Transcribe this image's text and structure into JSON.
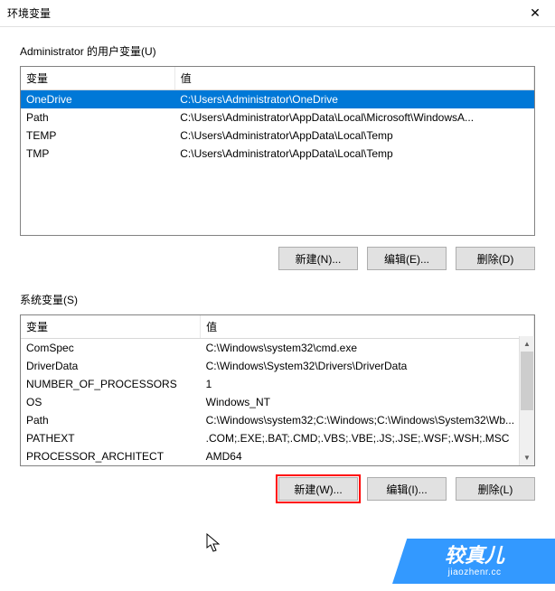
{
  "window": {
    "title": "环境变量"
  },
  "user_section": {
    "label": "Administrator 的用户变量(U)",
    "headers": {
      "variable": "变量",
      "value": "值"
    },
    "rows": [
      {
        "variable": "OneDrive",
        "value": "C:\\Users\\Administrator\\OneDrive",
        "selected": true
      },
      {
        "variable": "Path",
        "value": "C:\\Users\\Administrator\\AppData\\Local\\Microsoft\\WindowsA...",
        "selected": false
      },
      {
        "variable": "TEMP",
        "value": "C:\\Users\\Administrator\\AppData\\Local\\Temp",
        "selected": false
      },
      {
        "variable": "TMP",
        "value": "C:\\Users\\Administrator\\AppData\\Local\\Temp",
        "selected": false
      }
    ],
    "buttons": {
      "new": "新建(N)...",
      "edit": "编辑(E)...",
      "delete": "删除(D)"
    }
  },
  "system_section": {
    "label": "系统变量(S)",
    "headers": {
      "variable": "变量",
      "value": "值"
    },
    "rows": [
      {
        "variable": "ComSpec",
        "value": "C:\\Windows\\system32\\cmd.exe"
      },
      {
        "variable": "DriverData",
        "value": "C:\\Windows\\System32\\Drivers\\DriverData"
      },
      {
        "variable": "NUMBER_OF_PROCESSORS",
        "value": "1"
      },
      {
        "variable": "OS",
        "value": "Windows_NT"
      },
      {
        "variable": "Path",
        "value": "C:\\Windows\\system32;C:\\Windows;C:\\Windows\\System32\\Wb..."
      },
      {
        "variable": "PATHEXT",
        "value": ".COM;.EXE;.BAT;.CMD;.VBS;.VBE;.JS;.JSE;.WSF;.WSH;.MSC"
      },
      {
        "variable": "PROCESSOR_ARCHITECT",
        "value": "AMD64"
      }
    ],
    "buttons": {
      "new": "新建(W)...",
      "edit": "编辑(I)...",
      "delete": "删除(L)"
    }
  },
  "watermark": {
    "main": "较真儿",
    "sub": "jiaozhenr.cc"
  }
}
